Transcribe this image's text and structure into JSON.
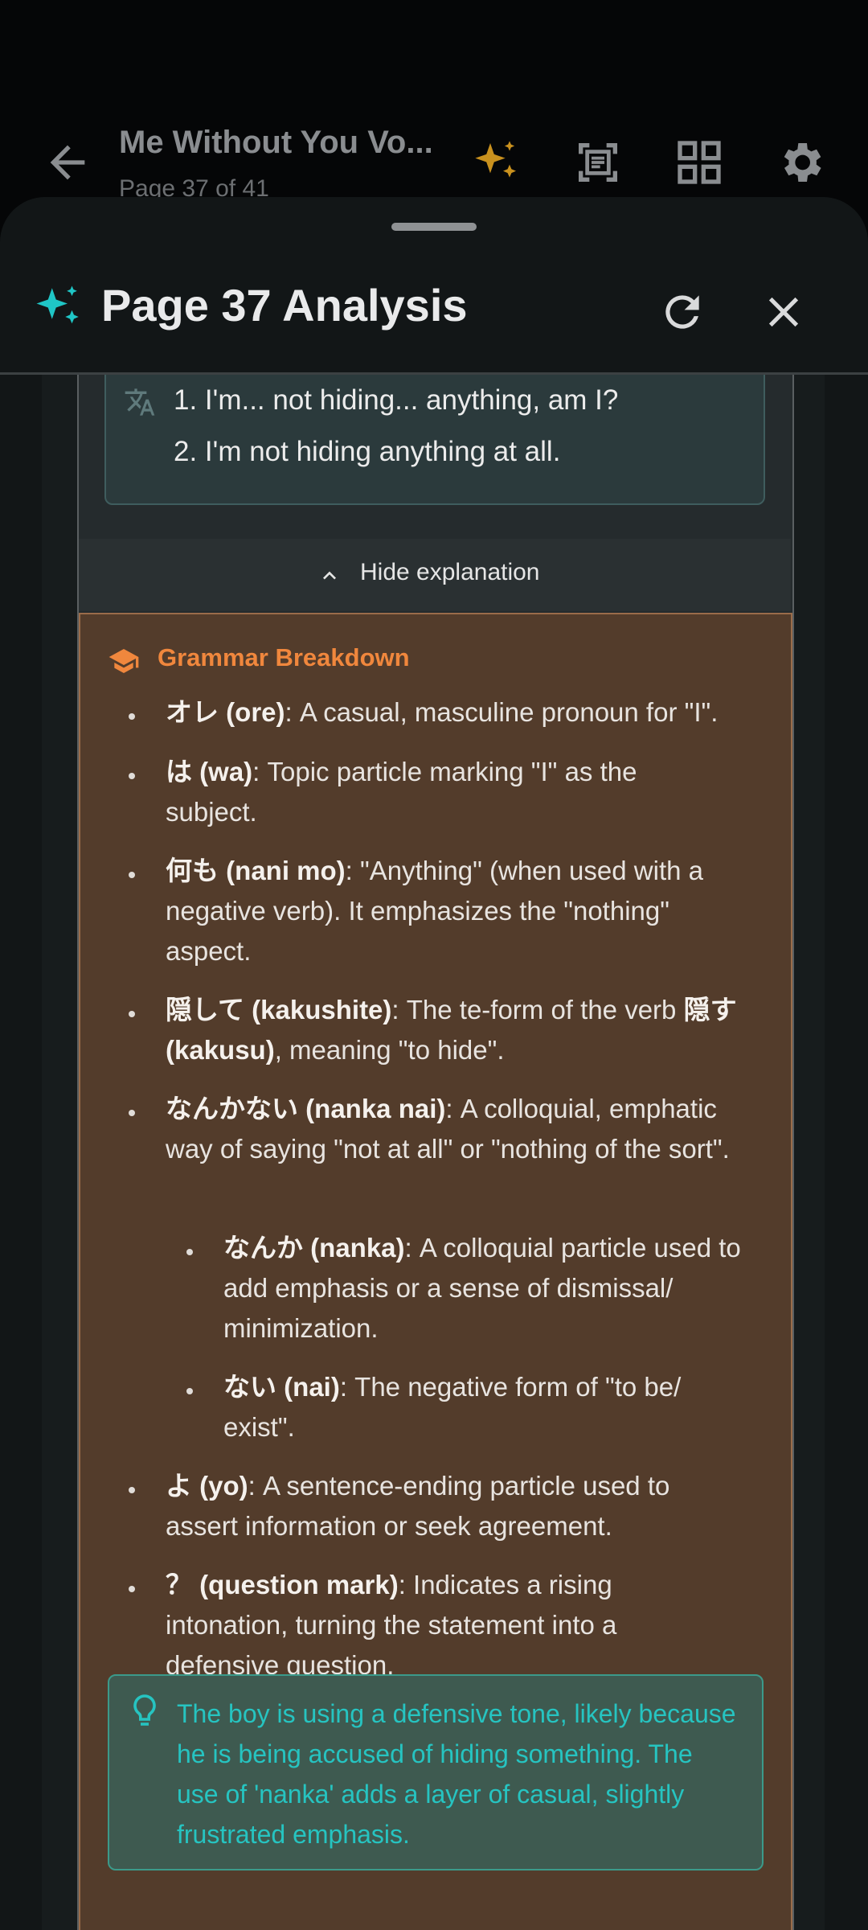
{
  "appbar": {
    "title": "Me Without You Vo...",
    "subtitle": "Page 37 of 41"
  },
  "sheet": {
    "title": "Page 37 Analysis"
  },
  "translation": {
    "lines": [
      "1. I'm... not hiding... anything, am I?",
      "2. I'm not hiding anything at all."
    ]
  },
  "explanation": {
    "toggle_label": "Hide explanation"
  },
  "grammar": {
    "heading": "Grammar Breakdown",
    "items": [
      {
        "term": "オレ (ore)",
        "desc": ": A casual, masculine pronoun for \"I\"."
      },
      {
        "term": "は (wa)",
        "desc": ": Topic particle marking \"I\" as the subject."
      },
      {
        "term": "何も (nani mo)",
        "desc": ": \"Anything\" (when used with a negative verb). It emphasizes the \"nothing\" aspect."
      },
      {
        "term": "隠して (kakushite)",
        "desc": ": The te-form of the verb ",
        "term2": "隠す (kakusu)",
        "desc2": ", meaning \"to hide\"."
      },
      {
        "term": "なんかない (nanka nai)",
        "desc": ": A colloquial, emphatic way of saying \"not at all\" or \"nothing of the sort\"."
      },
      {
        "term": "なんか (nanka)",
        "desc": ": A colloquial particle used to add emphasis or a sense of dismissal/ minimization."
      },
      {
        "term": "ない (nai)",
        "desc": ": The negative form of \"to be/ exist\"."
      },
      {
        "term": "よ (yo)",
        "desc": ": A sentence-ending particle used to assert information or seek agreement."
      },
      {
        "term": "？ (question mark)",
        "desc": ": Indicates a rising intonation, turning the statement into a defensive question."
      }
    ]
  },
  "tip": {
    "text": "The boy is using a defensive tone, likely because he is being accused of hiding something. The use of 'nanka' adds a layer of casual, slightly frustrated emphasis."
  },
  "icons": {
    "back": "arrow-left-icon",
    "ai": "sparkle-icon",
    "scan": "document-scan-icon",
    "grid": "grid-icon",
    "settings": "gear-icon",
    "refresh": "refresh-icon",
    "close": "close-icon",
    "translate": "translate-icon",
    "chevron": "chevron-up-icon",
    "school": "graduation-cap-icon",
    "tip": "lightbulb-icon"
  },
  "colors": {
    "accent": "#1fc6c6",
    "grammar_heading": "#f0873d",
    "sparkle_gold": "#c9911e"
  }
}
